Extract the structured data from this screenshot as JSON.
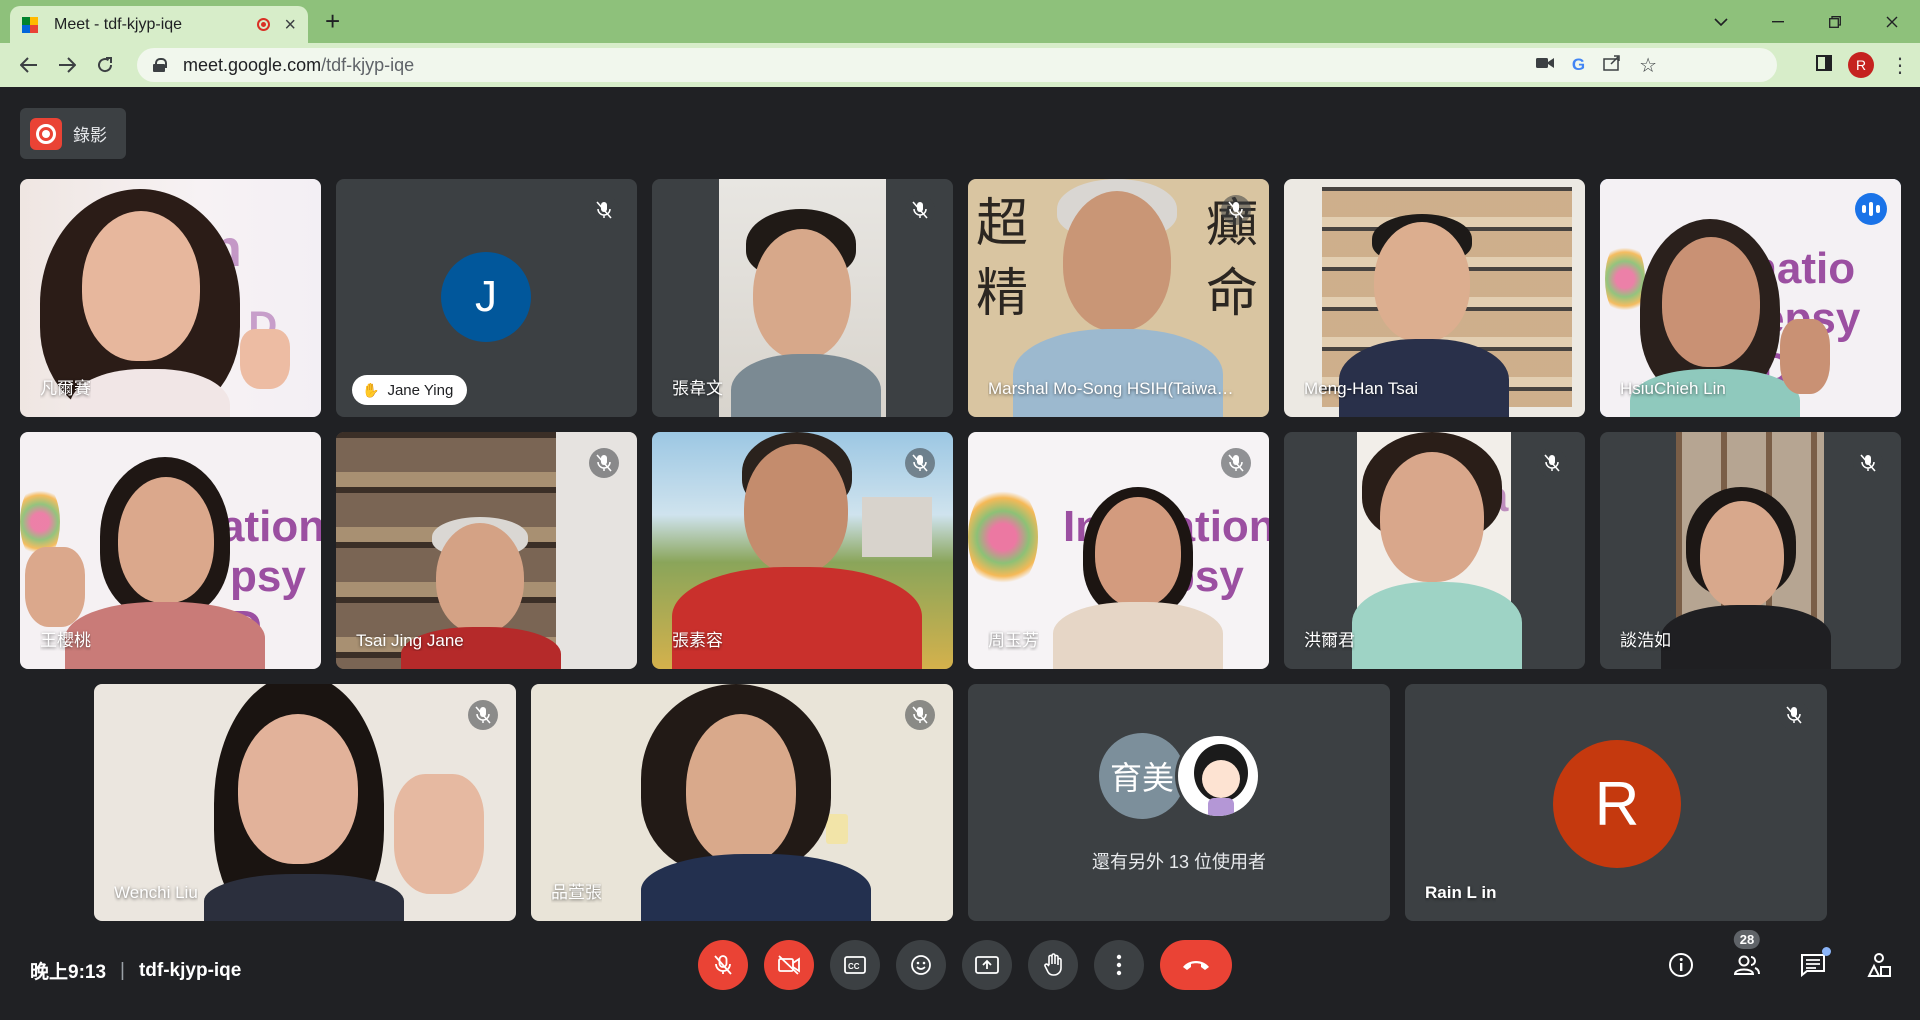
{
  "browser": {
    "tab_title": "Meet - tdf-kjyp-iqe",
    "url_host": "meet.google.com",
    "url_path": "/tdf-kjyp-iqe",
    "profile_initial": "R"
  },
  "recording": {
    "label": "錄影"
  },
  "participants": [
    {
      "name": "凡爾賽",
      "muted": false
    },
    {
      "name": "Jane Ying",
      "muted": true,
      "avatar_initial": "J",
      "hand_raised": true
    },
    {
      "name": "張韋文",
      "muted": true
    },
    {
      "name": "Marshal Mo-Song HSIH(Taiwa…",
      "muted": true
    },
    {
      "name": "Meng-Han Tsai",
      "muted": false
    },
    {
      "name": "HsiuChieh Lin",
      "muted": false,
      "speaking": true
    },
    {
      "name": "王櫻桃",
      "muted": false
    },
    {
      "name": "Tsai Jing Jane",
      "muted": true
    },
    {
      "name": "張素容",
      "muted": true
    },
    {
      "name": "周玉芳",
      "muted": true
    },
    {
      "name": "洪爾君",
      "muted": true
    },
    {
      "name": "談浩如",
      "muted": true
    },
    {
      "name": "Wenchi Liu",
      "muted": true
    },
    {
      "name": "品萱張",
      "muted": true
    },
    {
      "name": "Rain L in",
      "muted": true,
      "avatar_initial": "R"
    }
  ],
  "background_text": {
    "calligraphy_top": "超",
    "calligraphy_top2": "癲",
    "calligraphy_bottom": "精",
    "calligraphy_bottom2": "命",
    "banner_1": "natio",
    "banner_2": "epsy D",
    "banner_3": "ation",
    "banner_4": "psy D",
    "banner_5": "Inernation",
    "banner_6": "psy D",
    "banner_7": "na",
    "banner_8": "y D"
  },
  "others_tile": {
    "avatar_text": "育美",
    "label": "還有另外 13 位使用者"
  },
  "bottom_bar": {
    "time": "晚上9:13",
    "separator": "|",
    "meeting_code": "tdf-kjyp-iqe",
    "participant_count": "28"
  },
  "colors": {
    "accent_blue": "#1a73e8",
    "danger_red": "#ea4335",
    "tile_bg": "#3c4043",
    "page_bg": "#202124",
    "chrome_green": "#8ec17b"
  },
  "icons": {
    "mic": "mic-off-icon",
    "camera": "videocam-off-icon",
    "captions": "closed-caption-icon",
    "emoji": "emoji-icon",
    "present": "present-screen-icon",
    "hand": "raise-hand-icon",
    "more": "more-vert-icon",
    "hangup": "call-end-icon",
    "info": "info-icon",
    "people": "people-icon",
    "chat": "chat-icon",
    "activities": "activities-icon"
  }
}
